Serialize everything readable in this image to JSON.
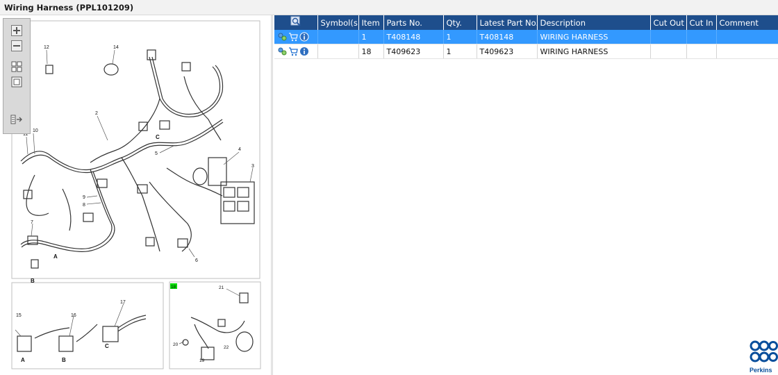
{
  "window": {
    "title": "Wiring Harness (PPL101209)"
  },
  "icons": {
    "zoom_in": "zoom-in-icon",
    "zoom_out": "zoom-out-icon",
    "fit": "fit-grid-icon",
    "single": "single-view-icon",
    "list": "list-link-icon"
  },
  "diagram": {
    "callouts": [
      "12",
      "14",
      "2",
      "10",
      "11",
      "C",
      "5",
      "4",
      "3",
      "9",
      "8",
      "7",
      "A",
      "B",
      "6"
    ],
    "inset_labels": [
      "15",
      "16",
      "17",
      "A",
      "B",
      "C"
    ],
    "detail_labels": [
      "18",
      "21",
      "20",
      "19",
      "22"
    ],
    "highlight_color": "#00dd00"
  },
  "table": {
    "header_icon": "search-zoom-icon",
    "columns": [
      "Symbol(s)",
      "Item",
      "Parts No.",
      "Qty.",
      "Latest Part No.",
      "Description",
      "Cut Out",
      "Cut In",
      "Comment"
    ],
    "rows": [
      {
        "item": "1",
        "part_no": "T408148",
        "qty": "1",
        "latest": "T408148",
        "description": "WIRING HARNESS",
        "cut_out": "",
        "cut_in": "",
        "comment": "",
        "selected": true
      },
      {
        "item": "18",
        "part_no": "T409623",
        "qty": "1",
        "latest": "T409623",
        "description": "WIRING HARNESS",
        "cut_out": "",
        "cut_in": "",
        "comment": "",
        "selected": false
      }
    ]
  },
  "brand": {
    "name": "Perkins",
    "color": "#0a4f9c"
  },
  "colors": {
    "header": "#1e4e8c",
    "selection": "#3399ff"
  }
}
